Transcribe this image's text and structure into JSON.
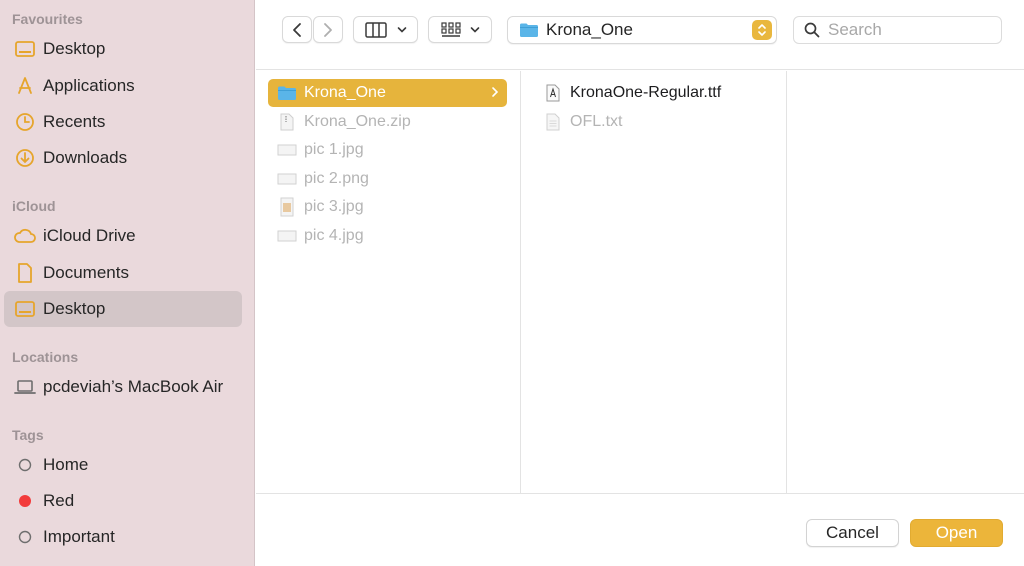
{
  "sidebar": {
    "favourites_title": "Favourites",
    "favourites": [
      {
        "label": "Desktop",
        "icon": "desktop-icon"
      },
      {
        "label": "Applications",
        "icon": "applications-icon"
      },
      {
        "label": "Recents",
        "icon": "clock-icon"
      },
      {
        "label": "Downloads",
        "icon": "download-icon"
      }
    ],
    "icloud_title": "iCloud",
    "icloud": [
      {
        "label": "iCloud Drive",
        "icon": "cloud-icon"
      },
      {
        "label": "Documents",
        "icon": "document-icon"
      },
      {
        "label": "Desktop",
        "icon": "desktop-icon",
        "selected": true
      }
    ],
    "locations_title": "Locations",
    "locations": [
      {
        "label": "pcdeviah’s MacBook Air",
        "icon": "laptop-icon"
      }
    ],
    "tags_title": "Tags",
    "tags": [
      {
        "label": "Home",
        "color": "none"
      },
      {
        "label": "Red",
        "color": "#f23b3b"
      },
      {
        "label": "Important",
        "color": "none"
      }
    ]
  },
  "toolbar": {
    "path_label": "Krona_One",
    "search_placeholder": "Search"
  },
  "columns": {
    "col1": [
      {
        "label": "Krona_One",
        "type": "folder",
        "selected": true
      },
      {
        "label": "Krona_One.zip",
        "type": "zip"
      },
      {
        "label": "pic 1.jpg",
        "type": "image"
      },
      {
        "label": "pic 2.png",
        "type": "image"
      },
      {
        "label": "pic 3.jpg",
        "type": "image-portrait"
      },
      {
        "label": "pic 4.jpg",
        "type": "image"
      }
    ],
    "col2": [
      {
        "label": "KronaOne-Regular.ttf",
        "type": "font",
        "enabled": true
      },
      {
        "label": "OFL.txt",
        "type": "text",
        "enabled": false
      }
    ]
  },
  "buttons": {
    "cancel": "Cancel",
    "open": "Open"
  },
  "colors": {
    "accent": "#e6b43c",
    "sidebar_bg": "#ead9dc",
    "folder_blue": "#5ab5e8"
  }
}
